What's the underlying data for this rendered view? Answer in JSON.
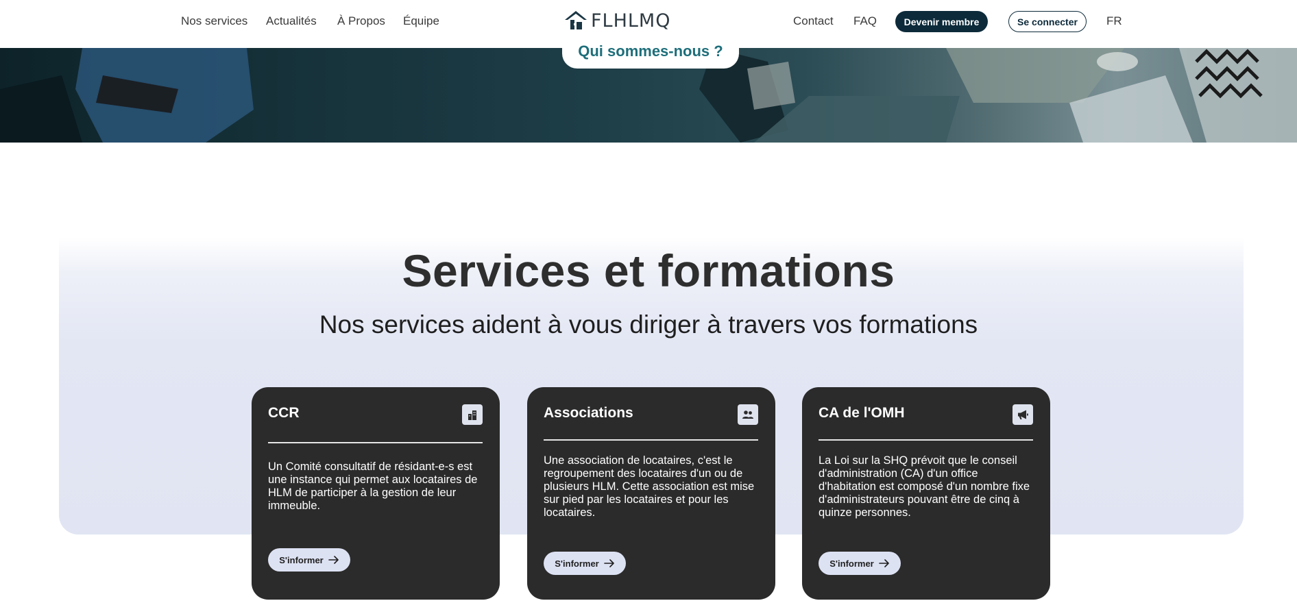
{
  "header": {
    "nav_left": [
      "Nos services",
      "Actualités",
      "À Propos",
      "Équipe"
    ],
    "logo_text": "FLHLMQ",
    "contact": "Contact",
    "faq": "FAQ",
    "member_button": "Devenir membre",
    "login_button": "Se connecter",
    "language": "FR"
  },
  "hero": {
    "about_button": "Qui sommes-nous ?"
  },
  "services": {
    "title": "Services et formations",
    "subtitle": "Nos services aident à vous diriger à travers vos formations",
    "cards": [
      {
        "title": "CCR",
        "icon": "building-icon",
        "text": "Un Comité consultatif de résidant-e-s est une instance qui permet aux locataires de HLM de participer à la gestion de leur immeuble.",
        "button": "S'informer"
      },
      {
        "title": "Associations",
        "icon": "users-icon",
        "text": "Une association de locataires, c'est le regroupement des locataires d'un ou de plusieurs HLM. Cette association est mise sur pied par les locataires et pour les locataires.",
        "button": "S'informer"
      },
      {
        "title": "CA de l'OMH",
        "icon": "megaphone-icon",
        "text": "La Loi sur la SHQ prévoit que le conseil d'administration (CA) d'un office d'habitation est composé d'un nombre fixe d'administrateurs pouvant être de cinq à quinze personnes.",
        "button": "S'informer"
      }
    ]
  },
  "colors": {
    "primary_dark": "#0c2a3a",
    "card_bg": "#2b2b2b",
    "section_bg": "#e1e5f3",
    "accent_teal": "#1d6e7a",
    "button_light": "#dde2f3"
  }
}
